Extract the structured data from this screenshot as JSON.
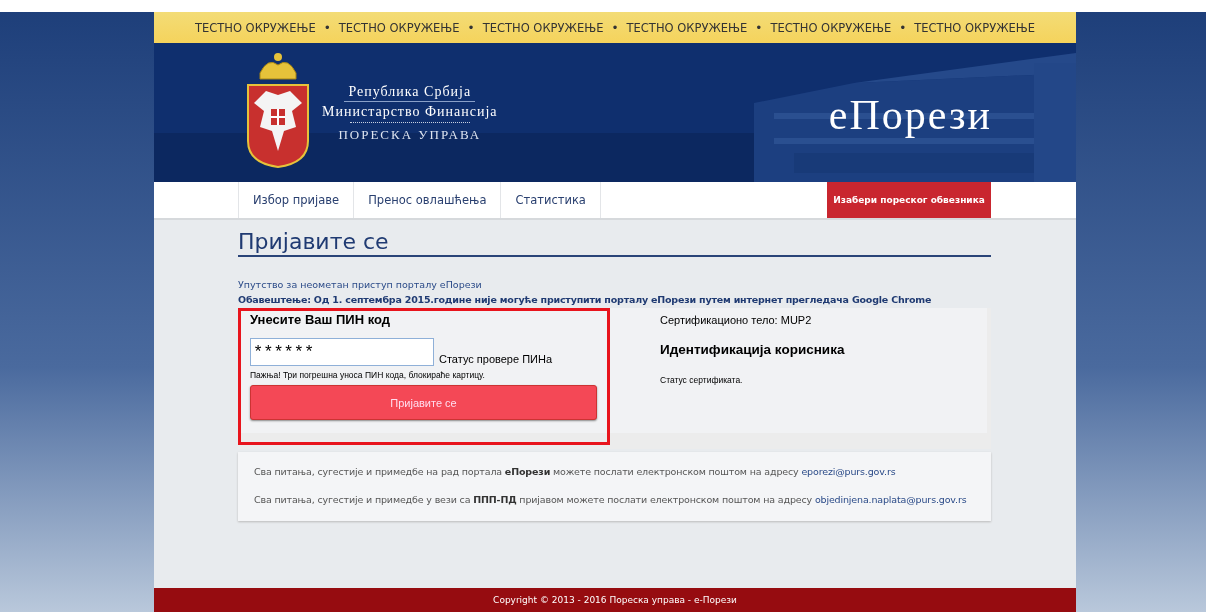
{
  "test_banner": [
    "ТЕСТНО ОКРУЖЕЊЕ",
    "•",
    "ТЕСТНО ОКРУЖЕЊЕ",
    "•",
    "ТЕСТНО ОКРУЖЕЊЕ",
    "•",
    "ТЕСТНО ОКРУЖЕЊЕ",
    "•",
    "ТЕСТНО ОКРУЖЕЊЕ",
    "•",
    "ТЕСТНО ОКРУЖЕЊЕ"
  ],
  "header": {
    "org_lines": [
      "Република Србија",
      "Министарство Финансија",
      "ПОРЕСКА УПРАВА"
    ],
    "site_title": "еПорези"
  },
  "nav": {
    "items": [
      {
        "label": "Избор пријаве",
        "selected": false
      },
      {
        "label": "Пренос овлашћења",
        "selected": false
      },
      {
        "label": "Статистика",
        "selected": false
      }
    ],
    "action_button": "Изабери пореског обвезника"
  },
  "page_title": "Пријавите се",
  "guide_link": "Упутство за неометан приступ порталу еПорези",
  "notice": "Обавештење: Од 1. септембра 2015.године није могуће приступити порталу еПорези путем интернет прегледача Google Chrome",
  "login": {
    "heading": "Унесите Ваш ПИН код",
    "pin_value": "******",
    "pin_status": "Статус провере ПИНа",
    "warning": "Пажња! Три погрешна уноса ПИН кода, блокираће картицу.",
    "button": "Пријавите се",
    "highlighted": true
  },
  "certificate": {
    "authority": "Сертификационо тело:  MUP2",
    "heading": "Идентификација корисника",
    "status": "Статус сертификата."
  },
  "contacts": [
    {
      "text": "Сва питања, сугестије и примедбе на рад портала **еПорези** можете послати електронском поштом на адресу",
      "email": "eporezi@purs.gov.rs"
    },
    {
      "text": "Сва питања, сугестије и примедбе у вези са **ППП-ПД** пријавом можете послати електронском поштом на адресу",
      "email": "objedinjena.naplata@purs.gov.rs"
    }
  ],
  "footer": "Copyright © 2013 - 2016 Пореска управа - е-Порези"
}
